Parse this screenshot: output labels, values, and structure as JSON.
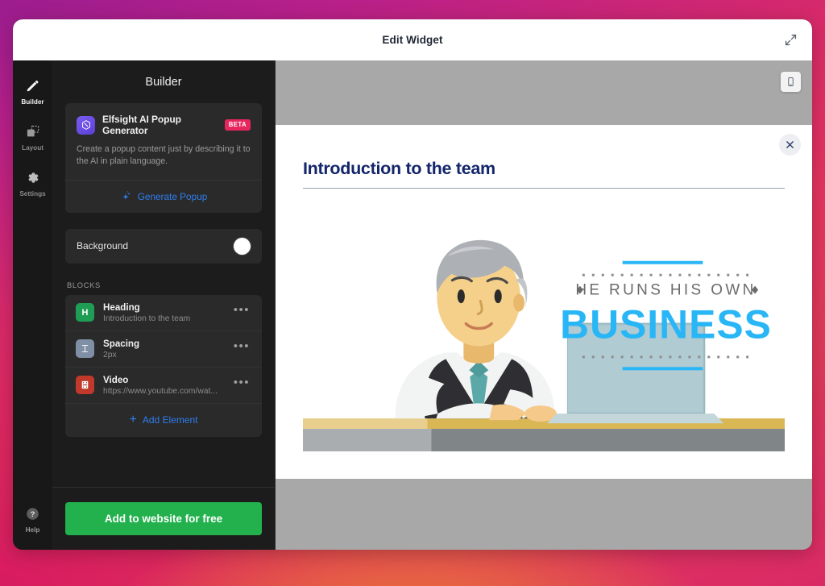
{
  "window": {
    "title": "Edit Widget",
    "expand_icon": "expand-diagonal-icon"
  },
  "rail": {
    "items": [
      {
        "label": "Builder",
        "icon": "pencil-icon",
        "active": true
      },
      {
        "label": "Layout",
        "icon": "layout-icon",
        "active": false
      },
      {
        "label": "Settings",
        "icon": "gear-icon",
        "active": false
      }
    ],
    "help": {
      "label": "Help",
      "icon": "question-mark-icon"
    }
  },
  "panel": {
    "title": "Builder",
    "ai_card": {
      "logo_icon": "elfsight-logo-icon",
      "title": "Elfsight AI Popup Generator",
      "badge": "BETA",
      "description": "Create a popup content just by describing it to the AI in plain language.",
      "generate_label": "Generate Popup",
      "generate_icon": "sparkles-icon"
    },
    "background": {
      "label": "Background",
      "swatch_color": "#ffffff"
    },
    "blocks_label": "BLOCKS",
    "blocks": [
      {
        "title": "Heading",
        "subtitle": "Introduction to the team",
        "icon": "heading-icon",
        "icon_color": "#1f9d55",
        "icon_glyph": "H",
        "menu_icon": "ellipsis-icon"
      },
      {
        "title": "Spacing",
        "subtitle": "2px",
        "icon": "spacing-icon",
        "icon_color": "#7f8fa6",
        "icon_glyph": "I",
        "menu_icon": "ellipsis-icon"
      },
      {
        "title": "Video",
        "subtitle": "https://www.youtube.com/wat...",
        "icon": "video-icon",
        "icon_color": "#c0392b",
        "icon_glyph": "F",
        "menu_icon": "ellipsis-icon"
      }
    ],
    "add_element_label": "Add Element",
    "add_element_icon": "plus-icon",
    "cta_label": "Add to website for free",
    "cta_color": "#22b14c"
  },
  "canvas": {
    "device_toggle_icon": "mobile-phone-icon",
    "popup": {
      "close_icon": "close-x-icon",
      "heading": "Introduction to the team",
      "heading_color": "#13256b",
      "video": {
        "poster_alt": "man-working-at-laptop-illustration",
        "caption_small": "HE RUNS HIS OWN",
        "caption_large": "BUSINESS",
        "caption_color": "#29b6f6",
        "caption_small_color": "#6b6b6b"
      }
    }
  },
  "theme": {
    "accent_blue": "#2f7df0",
    "badge_pink": "#e8265e",
    "panel_bg": "#1c1c1c",
    "card_bg": "#2a2a2a"
  }
}
